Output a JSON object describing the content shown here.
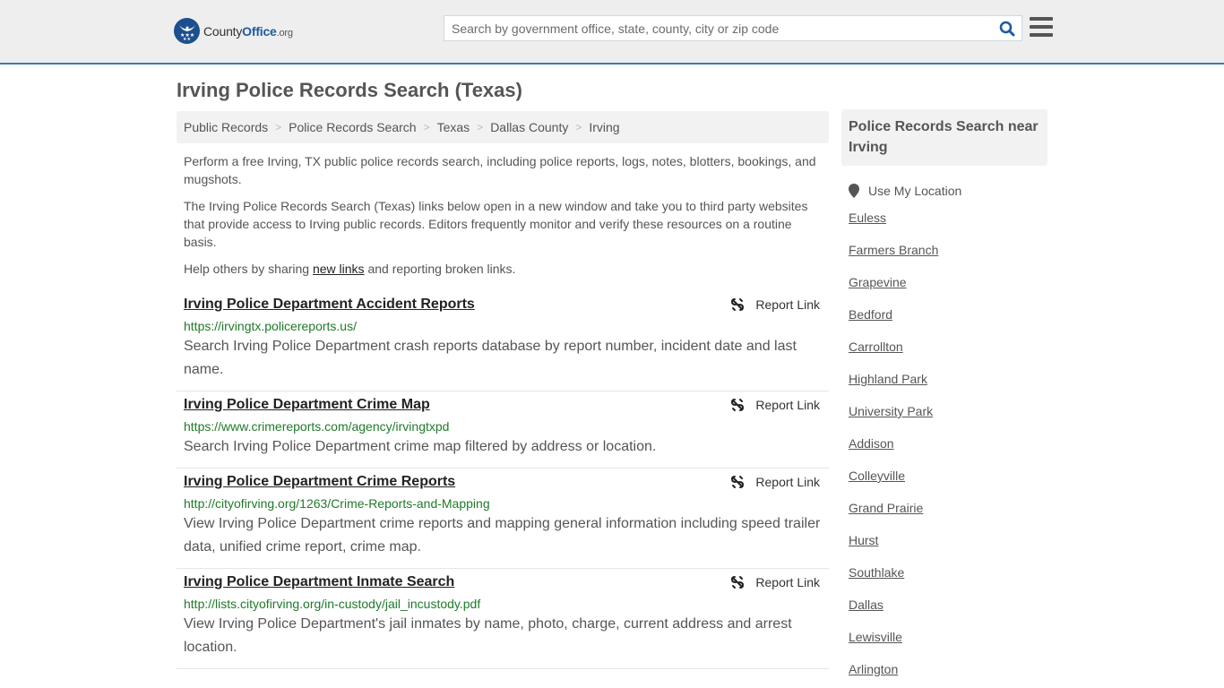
{
  "header": {
    "logo": {
      "county": "County",
      "office": "Office",
      "org": ".org"
    },
    "search": {
      "placeholder": "Search by government office, state, county, city or zip code",
      "value": ""
    },
    "colors": {
      "accent": "#3a7bb2",
      "logo_blue": "#1c4f8f",
      "url_green": "#207a2a"
    }
  },
  "page": {
    "title": "Irving Police Records Search (Texas)"
  },
  "breadcrumb": [
    {
      "label": "Public Records"
    },
    {
      "label": "Police Records Search"
    },
    {
      "label": "Texas"
    },
    {
      "label": "Dallas County"
    },
    {
      "label": "Irving"
    }
  ],
  "intro": {
    "p1": "Perform a free Irving, TX public police records search, including police reports, logs, notes, blotters, bookings, and mugshots.",
    "p2": "The Irving Police Records Search (Texas) links below open in a new window and take you to third party websites that provide access to Irving public records. Editors frequently monitor and verify these resources on a routine basis.",
    "p3_before": "Help others by sharing ",
    "p3_link": "new links",
    "p3_after": " and reporting broken links."
  },
  "results": [
    {
      "title": "Irving Police Department Accident Reports",
      "url": "https://irvingtx.policereports.us/",
      "description": "Search Irving Police Department crash reports database by report number, incident date and last name.",
      "report_label": "Report Link"
    },
    {
      "title": "Irving Police Department Crime Map",
      "url": "https://www.crimereports.com/agency/irvingtxpd",
      "description": "Search Irving Police Department crime map filtered by address or location.",
      "report_label": "Report Link"
    },
    {
      "title": "Irving Police Department Crime Reports",
      "url": "http://cityofirving.org/1263/Crime-Reports-and-Mapping",
      "description": "View Irving Police Department crime reports and mapping general information including speed trailer data, unified crime report, crime map.",
      "report_label": "Report Link"
    },
    {
      "title": "Irving Police Department Inmate Search",
      "url": "http://lists.cityofirving.org/in-custody/jail_incustody.pdf",
      "description": "View Irving Police Department's jail inmates by name, photo, charge, current address and arrest location.",
      "report_label": "Report Link"
    }
  ],
  "sidebar": {
    "heading": "Police Records Search near Irving",
    "use_location": "Use My Location",
    "cities": [
      "Euless",
      "Farmers Branch",
      "Grapevine",
      "Bedford",
      "Carrollton",
      "Highland Park",
      "University Park",
      "Addison",
      "Colleyville",
      "Grand Prairie",
      "Hurst",
      "Southlake",
      "Dallas",
      "Lewisville",
      "Arlington"
    ]
  }
}
